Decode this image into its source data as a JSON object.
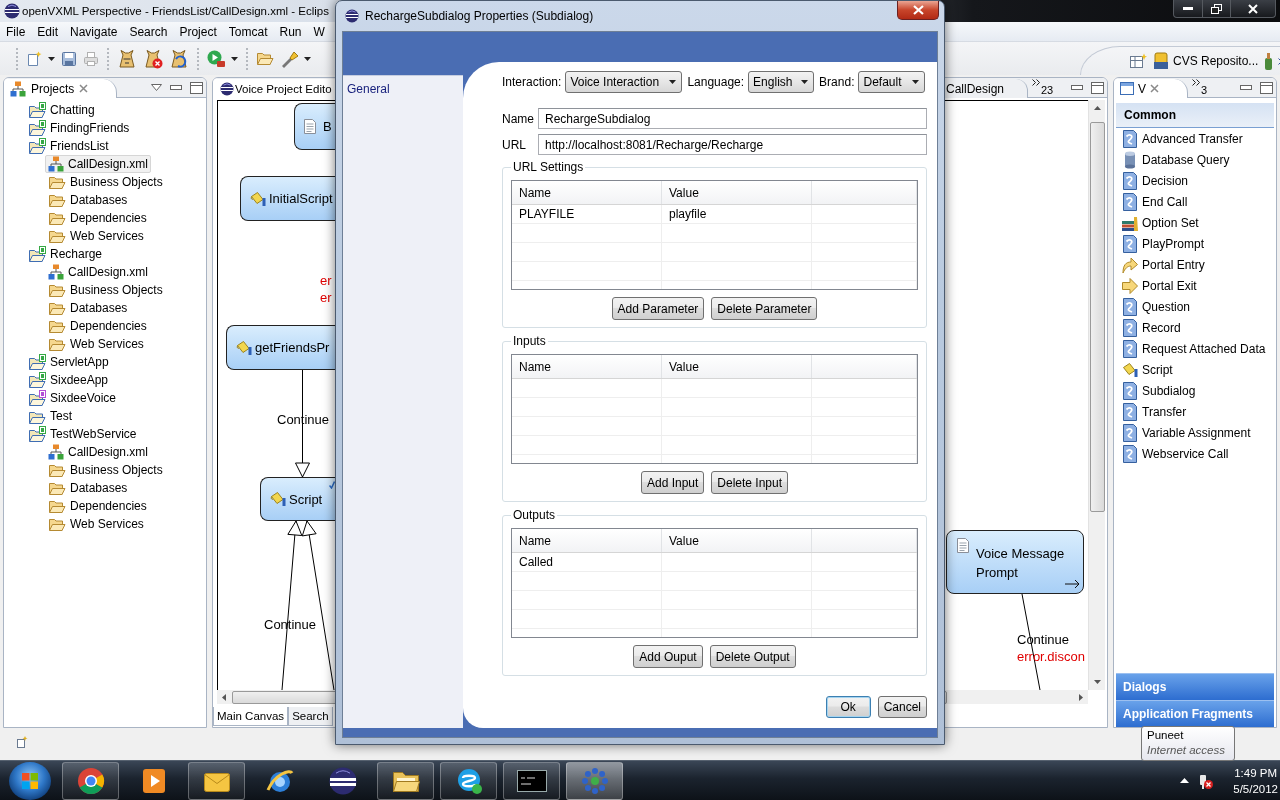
{
  "window": {
    "title": "openVXML Perspective - FriendsList/CallDesign.xml - Eclips"
  },
  "menu": [
    "File",
    "Edit",
    "Navigate",
    "Search",
    "Project",
    "Tomcat",
    "Run",
    "W"
  ],
  "perspectives": [
    {
      "label": "CVS Reposito..."
    }
  ],
  "projects": {
    "title": "Projects",
    "tree": [
      {
        "label": "Chatting",
        "kind": "voice-project",
        "selected": false
      },
      {
        "label": "FindingFriends",
        "kind": "voice-project",
        "selected": false
      },
      {
        "label": "FriendsList",
        "kind": "voice-project",
        "selected": false,
        "children": [
          {
            "label": "CallDesign.xml",
            "kind": "design",
            "selected": true
          },
          {
            "label": "Business Objects",
            "kind": "folder",
            "selected": false
          },
          {
            "label": "Databases",
            "kind": "folder",
            "selected": false
          },
          {
            "label": "Dependencies",
            "kind": "folder",
            "selected": false
          },
          {
            "label": "Web Services",
            "kind": "folder",
            "selected": false
          }
        ]
      },
      {
        "label": "Recharge",
        "kind": "voice-project",
        "selected": false,
        "children": [
          {
            "label": "CallDesign.xml",
            "kind": "design",
            "selected": false
          },
          {
            "label": "Business Objects",
            "kind": "folder",
            "selected": false
          },
          {
            "label": "Databases",
            "kind": "folder",
            "selected": false
          },
          {
            "label": "Dependencies",
            "kind": "folder",
            "selected": false
          },
          {
            "label": "Web Services",
            "kind": "folder",
            "selected": false
          }
        ]
      },
      {
        "label": "ServletApp",
        "kind": "voice-project",
        "selected": false
      },
      {
        "label": "SixdeeApp",
        "kind": "voice-project",
        "selected": false
      },
      {
        "label": "SixdeeVoice",
        "kind": "other-project",
        "selected": false
      },
      {
        "label": "Test",
        "kind": "plain-project",
        "selected": false
      },
      {
        "label": "TestWebService",
        "kind": "voice-project",
        "selected": false,
        "children": [
          {
            "label": "CallDesign.xml",
            "kind": "design",
            "selected": false
          },
          {
            "label": "Business Objects",
            "kind": "folder",
            "selected": false
          },
          {
            "label": "Databases",
            "kind": "folder",
            "selected": false
          },
          {
            "label": "Dependencies",
            "kind": "folder",
            "selected": false
          },
          {
            "label": "Web Services",
            "kind": "folder",
            "selected": false
          }
        ]
      }
    ]
  },
  "editor": {
    "tabs": [
      {
        "label": "Voice Project Edito",
        "selected": true
      },
      {
        "label": "CallDesign",
        "selected": false
      }
    ],
    "more_tabs": "23",
    "canvas": {
      "nodes": [
        {
          "label": "B",
          "kind": "prompt"
        },
        {
          "label": "InitialScript",
          "kind": "script"
        },
        {
          "label": "getFriendsPr",
          "kind": "script"
        },
        {
          "label": "Script",
          "kind": "script"
        },
        {
          "label": "Voice Message Prompt",
          "kind": "prompt"
        }
      ],
      "labels": [
        {
          "text": "er",
          "kind": "error"
        },
        {
          "text": "er",
          "kind": "error"
        },
        {
          "text": "Continue",
          "kind": "path"
        },
        {
          "text": "Continue",
          "kind": "path"
        },
        {
          "text": "Continue",
          "kind": "path"
        },
        {
          "text": "error.discon",
          "kind": "error"
        }
      ]
    },
    "pages": [
      {
        "label": "Main Canvas",
        "selected": true
      },
      {
        "label": "Search",
        "selected": false
      }
    ]
  },
  "palette": {
    "tab": "V",
    "more_tabs": "3",
    "section": "Common",
    "items": [
      {
        "label": "Advanced Transfer",
        "kind": "action"
      },
      {
        "label": "Database Query",
        "kind": "database"
      },
      {
        "label": "Decision",
        "kind": "action"
      },
      {
        "label": "End Call",
        "kind": "action"
      },
      {
        "label": "Option Set",
        "kind": "option-set"
      },
      {
        "label": "PlayPrompt",
        "kind": "action"
      },
      {
        "label": "Portal Entry",
        "kind": "portal-entry"
      },
      {
        "label": "Portal Exit",
        "kind": "portal-exit"
      },
      {
        "label": "Question",
        "kind": "action"
      },
      {
        "label": "Record",
        "kind": "action"
      },
      {
        "label": "Request Attached Data",
        "kind": "action"
      },
      {
        "label": "Script",
        "kind": "script"
      },
      {
        "label": "Subdialog",
        "kind": "action"
      },
      {
        "label": "Transfer",
        "kind": "action"
      },
      {
        "label": "Variable Assignment",
        "kind": "action"
      },
      {
        "label": "Webservice Call",
        "kind": "action"
      }
    ],
    "drawers": [
      {
        "label": "Dialogs"
      },
      {
        "label": "Application Fragments"
      }
    ]
  },
  "dialog": {
    "title": "RechargeSubdialog Properties (Subdialog)",
    "nav": [
      {
        "label": "General"
      }
    ],
    "selectors": [
      {
        "label": "Interaction:",
        "value": "Voice Interaction"
      },
      {
        "label": "Language:",
        "value": "English"
      },
      {
        "label": "Brand:",
        "value": "Default"
      }
    ],
    "fields": [
      {
        "label": "Name",
        "value": "RechargeSubdialog"
      },
      {
        "label": "URL",
        "value": "http://localhost:8081/Recharge/Recharge"
      }
    ],
    "groups": [
      {
        "title": "URL Settings",
        "columns": [
          "Name",
          "Value"
        ],
        "rows": [
          [
            "PLAYFILE",
            "playfile"
          ]
        ],
        "buttons": [
          "Add Parameter",
          "Delete Parameter"
        ]
      },
      {
        "title": "Inputs",
        "columns": [
          "Name",
          "Value"
        ],
        "buttons": [
          "Add Input",
          "Delete Input"
        ]
      },
      {
        "title": "Outputs",
        "columns": [
          "Name",
          "Value"
        ],
        "rows": [
          [
            "Called"
          ]
        ],
        "buttons": [
          "Add Ouput",
          "Delete Output"
        ]
      }
    ],
    "buttons": [
      {
        "label": "Ok",
        "default": true
      },
      {
        "label": "Cancel",
        "default": false
      }
    ]
  },
  "tooltip": {
    "title": "Puneet",
    "text": "Internet access"
  },
  "taskbar": {
    "apps": [
      {
        "kind": "color-wheel",
        "running": true,
        "selected": false
      },
      {
        "kind": "media",
        "running": false,
        "selected": false
      },
      {
        "kind": "mail",
        "running": true,
        "selected": false
      },
      {
        "kind": "web",
        "running": false,
        "selected": false
      },
      {
        "kind": "sphere",
        "running": false,
        "selected": false
      },
      {
        "kind": "files",
        "running": true,
        "selected": false
      },
      {
        "kind": "chat",
        "running": true,
        "selected": false
      },
      {
        "kind": "terminal",
        "running": true,
        "selected": false
      },
      {
        "kind": "network-map",
        "running": true,
        "selected": true
      }
    ],
    "clock": {
      "time": "1:49 PM",
      "date": "5/5/2012"
    }
  }
}
